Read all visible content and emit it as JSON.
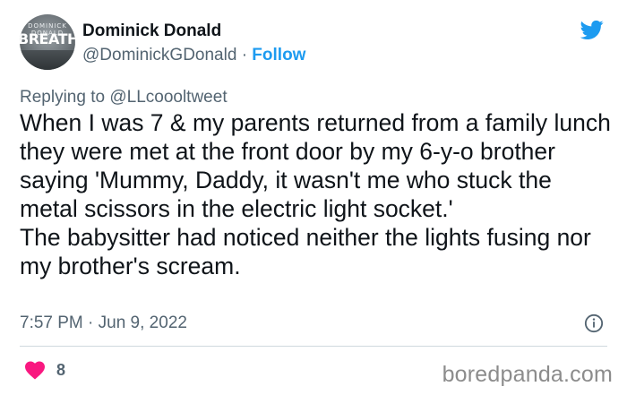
{
  "author": {
    "display_name": "Dominick Donald",
    "handle": "@DominickGDonald",
    "separator": "·",
    "follow_label": "Follow",
    "avatar_text_small": "DOMINICK DONALD",
    "avatar_text_big": "BREATHE"
  },
  "reply": {
    "prefix": "Replying to",
    "mention": "@LLcoooltweet"
  },
  "tweet": {
    "text": "When I was 7 & my parents returned from a family lunch they were met at the front door by my 6-y-o brother saying 'Mummy, Daddy, it wasn't me who stuck the metal scissors in the electric light socket.'\nThe babysitter had noticed neither the lights fusing nor my brother's scream.",
    "timestamp": "7:57 PM · Jun 9, 2022",
    "likes": "8"
  },
  "icons": {
    "brand": "twitter-bird-icon",
    "info": "info-icon",
    "like": "heart-icon"
  },
  "colors": {
    "accent": "#1d9bf0",
    "like": "#f91880",
    "muted_text": "#536471",
    "watermark": "#8c8c8c"
  },
  "watermark": "boredpanda.com"
}
